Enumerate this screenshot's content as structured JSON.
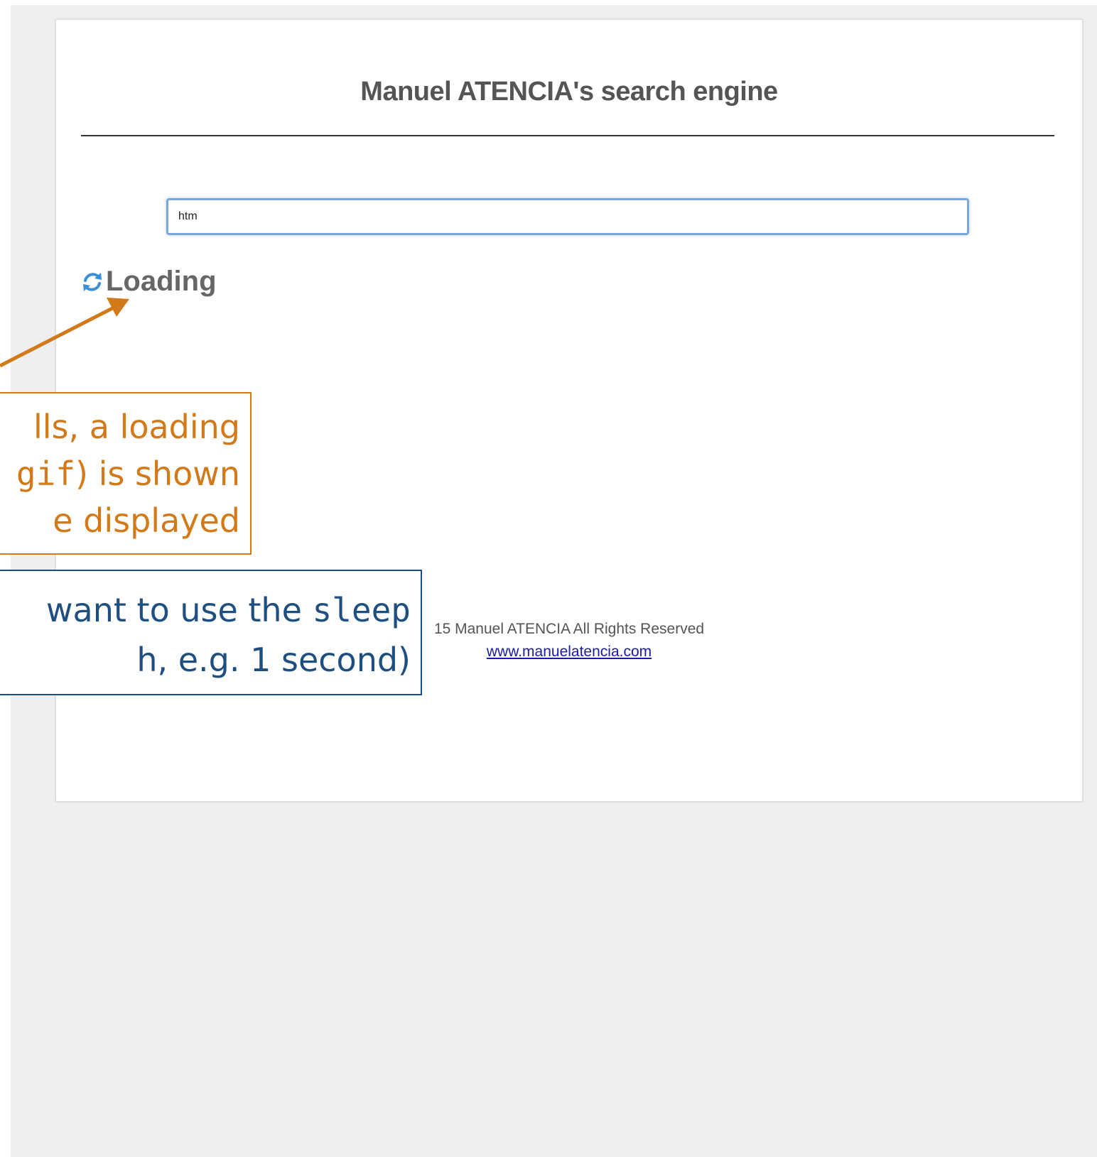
{
  "page": {
    "title": "Manuel ATENCIA's search engine",
    "search_value": "htm",
    "loading_label": "Loading",
    "footer_copyright": "15 Manuel ATENCIA All Rights Reserved",
    "footer_link": "www.manuelatencia.com"
  },
  "annotations": {
    "orange": {
      "line1": "lls, a loading",
      "line2_code": "gif",
      "line2_text": ") is shown",
      "line3": "e displayed"
    },
    "blue": {
      "line1_text": "want to use the ",
      "line1_code": "sleep",
      "line2": "h, e.g. 1 second)"
    }
  },
  "colors": {
    "page_background": "#efefef",
    "title_text": "#555555",
    "input_focus_border": "#7aa7dc",
    "loading_icon": "#3a8fd6",
    "link": "#1a1aa6",
    "annotation_orange": "#d27a1a",
    "annotation_blue": "#1f4e80"
  },
  "icons": {
    "loading": "refresh-spinner-icon"
  }
}
